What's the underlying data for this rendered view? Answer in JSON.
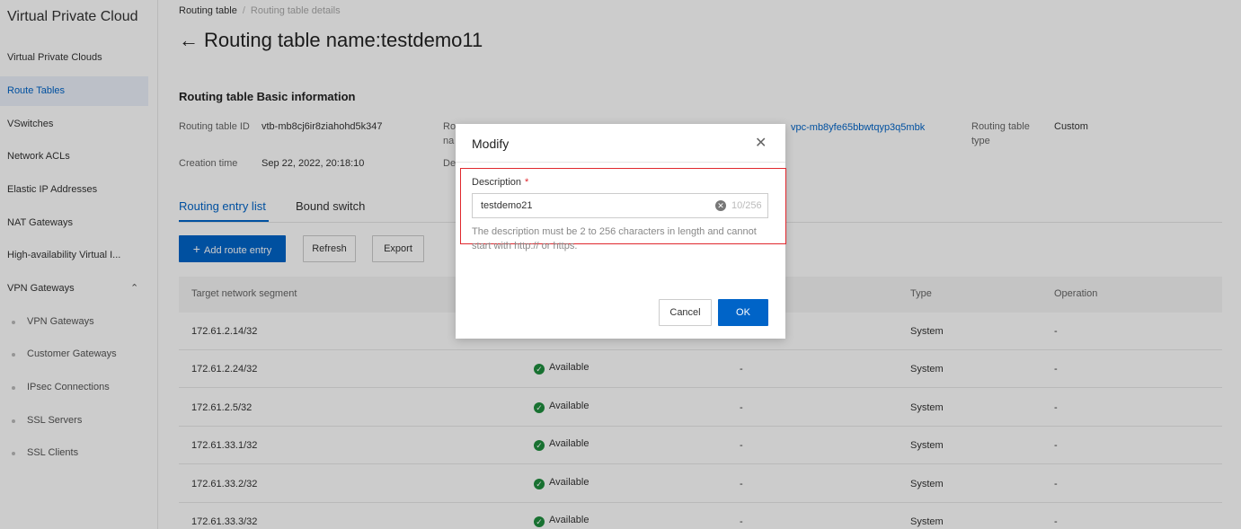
{
  "sidebar": {
    "title": "Virtual Private Cloud",
    "items": [
      {
        "label": "Virtual Private Clouds"
      },
      {
        "label": "Route Tables"
      },
      {
        "label": "VSwitches"
      },
      {
        "label": "Network ACLs"
      },
      {
        "label": "Elastic IP Addresses"
      },
      {
        "label": "NAT Gateways"
      },
      {
        "label": "High-availability Virtual I..."
      },
      {
        "label": "VPN Gateways"
      }
    ],
    "sub_items": [
      {
        "label": "VPN Gateways"
      },
      {
        "label": "Customer Gateways"
      },
      {
        "label": "IPsec Connections"
      },
      {
        "label": "SSL Servers"
      },
      {
        "label": "SSL Clients"
      }
    ]
  },
  "breadcrumb": {
    "root": "Routing table",
    "current": "Routing table details"
  },
  "page": {
    "title": "Routing table name:testdemo11"
  },
  "basic_info": {
    "section_title": "Routing table Basic information",
    "id_label": "Routing table ID",
    "id_value": "vtb-mb8cj6ir8ziahohd5k347",
    "created_label": "Creation time",
    "created_value": "Sep 22, 2022, 20:18:10",
    "name_label_partial": "Ro",
    "name_label_partial2": "na",
    "desc_label_partial": "De",
    "vpc_value": "vpc-mb8yfe65bbwtqyp3q5mbk",
    "type_label_1": "Routing table",
    "type_label_2": "type",
    "type_value": "Custom"
  },
  "tabs": [
    {
      "label": "Routing entry list"
    },
    {
      "label": "Bound switch"
    }
  ],
  "toolbar": {
    "add_label": "Add route entry",
    "refresh_label": "Refresh",
    "export_label": "Export"
  },
  "table": {
    "headers": {
      "target": "Target network segment",
      "type": "Type",
      "operation": "Operation"
    },
    "rows": [
      {
        "target": "172.61.2.14/32",
        "status": "",
        "next_hop": "",
        "type": "System",
        "operation": "-"
      },
      {
        "target": "172.61.2.24/32",
        "status": "Available",
        "next_hop": "-",
        "type": "System",
        "operation": "-"
      },
      {
        "target": "172.61.2.5/32",
        "status": "Available",
        "next_hop": "-",
        "type": "System",
        "operation": "-"
      },
      {
        "target": "172.61.33.1/32",
        "status": "Available",
        "next_hop": "-",
        "type": "System",
        "operation": "-"
      },
      {
        "target": "172.61.33.2/32",
        "status": "Available",
        "next_hop": "-",
        "type": "System",
        "operation": "-"
      },
      {
        "target": "172.61.33.3/32",
        "status": "Available",
        "next_hop": "-",
        "type": "System",
        "operation": "-"
      }
    ]
  },
  "modal": {
    "title": "Modify",
    "field_label": "Description",
    "required_mark": "*",
    "input_value": "testdemo21",
    "counter": "10/256",
    "hint": "The description must be 2 to 256 characters in length and cannot start with http:// or https.",
    "cancel_label": "Cancel",
    "ok_label": "OK"
  },
  "colors": {
    "accent": "#0064c8",
    "highlight": "#e0282e",
    "success": "#1e8e3e"
  }
}
